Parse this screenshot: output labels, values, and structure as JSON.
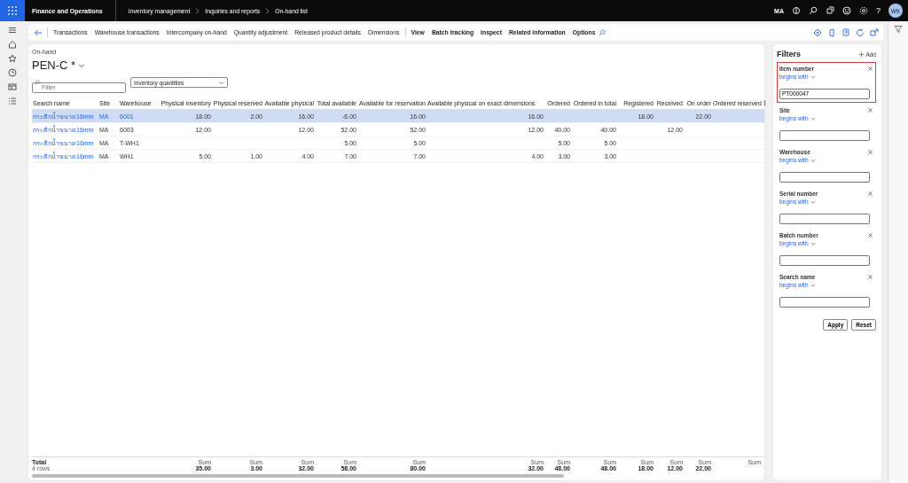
{
  "top_bar": {
    "app_name": "Finance and Operations",
    "breadcrumbs": [
      "Inventory management",
      "Inquiries and reports",
      "On-hand list"
    ],
    "company": "MA",
    "help": "?",
    "avatar": "WK"
  },
  "toolbar": {
    "actions": [
      "Transactions",
      "Warehouse transactions",
      "Intercompany on-hand",
      "Quantity adjustment",
      "Released product details",
      "Dimensions"
    ],
    "menus": [
      "View",
      "Batch tracking",
      "Inspect",
      "Related information",
      "Options"
    ]
  },
  "page": {
    "caption": "On-hand",
    "title": "PEN-C *",
    "filter_placeholder": "Filter",
    "view_select": "Inventory quantities"
  },
  "table": {
    "columns": [
      "Search name",
      "Site",
      "Warehouse",
      "Physical inventory",
      "Physical reserved",
      "Available physical",
      "Total available",
      "Available for reservation",
      "Available physical on exact dimensions",
      "Ordered",
      "Ordered in total",
      "Registered",
      "Received",
      "On order",
      "Ordered reserved"
    ],
    "rows": [
      {
        "selected": true,
        "cells": [
          "กระติกน้ำขนาด16mm",
          "MA",
          "6001",
          "18.00",
          "2.00",
          "16.00",
          "-6.00",
          "16.00",
          "16.00",
          "",
          "",
          "18.00",
          "",
          "22.00",
          ""
        ]
      },
      {
        "selected": false,
        "cells": [
          "กระติกน้ำขนาด16mm",
          "MA",
          "6003",
          "12.00",
          "",
          "12.00",
          "52.00",
          "52.00",
          "12.00",
          "40.00",
          "40.00",
          "",
          "12.00",
          "",
          ""
        ]
      },
      {
        "selected": false,
        "cells": [
          "กระติกน้ำขนาด16mm",
          "MA",
          "T-WH1",
          "",
          "",
          "",
          "5.00",
          "5.00",
          "",
          "5.00",
          "5.00",
          "",
          "",
          "",
          ""
        ]
      },
      {
        "selected": false,
        "cells": [
          "กระติกน้ำขนาด16mm",
          "MA",
          "WH1",
          "5.00",
          "1.00",
          "4.00",
          "7.00",
          "7.00",
          "4.00",
          "3.00",
          "3.00",
          "",
          "",
          "",
          ""
        ]
      }
    ],
    "footer": {
      "title": "Total",
      "count": "4 rows",
      "sums": [
        {
          "label": "Sum",
          "value": "35.00"
        },
        {
          "label": "Sum",
          "value": "3.00"
        },
        {
          "label": "Sum",
          "value": "32.00"
        },
        {
          "label": "Sum",
          "value": "58.00"
        },
        {
          "label": "Sum",
          "value": "80.00"
        },
        {
          "label": "Sum",
          "value": "32.00"
        },
        {
          "label": "Sum",
          "value": "48.00"
        },
        {
          "label": "Sum",
          "value": "48.00"
        },
        {
          "label": "Sum",
          "value": "18.00"
        },
        {
          "label": "Sum",
          "value": "12.00"
        },
        {
          "label": "Sum",
          "value": "22.00"
        },
        {
          "label": "Sum"
        }
      ]
    }
  },
  "filters": {
    "title": "Filters",
    "add": "Add",
    "fields": [
      {
        "label": "Item number",
        "operator": "begins with",
        "value": "PT000047",
        "highlighted": true
      },
      {
        "label": "Site",
        "operator": "begins with",
        "highlighted": false
      },
      {
        "label": "Warehouse",
        "operator": "begins with",
        "highlighted": false
      },
      {
        "label": "Serial number",
        "operator": "begins with",
        "highlighted": false
      },
      {
        "label": "Batch number",
        "operator": "begins with",
        "highlighted": false
      },
      {
        "label": "Search name",
        "operator": "begins with",
        "highlighted": false
      }
    ],
    "buttons": [
      "Apply",
      "Reset"
    ]
  }
}
